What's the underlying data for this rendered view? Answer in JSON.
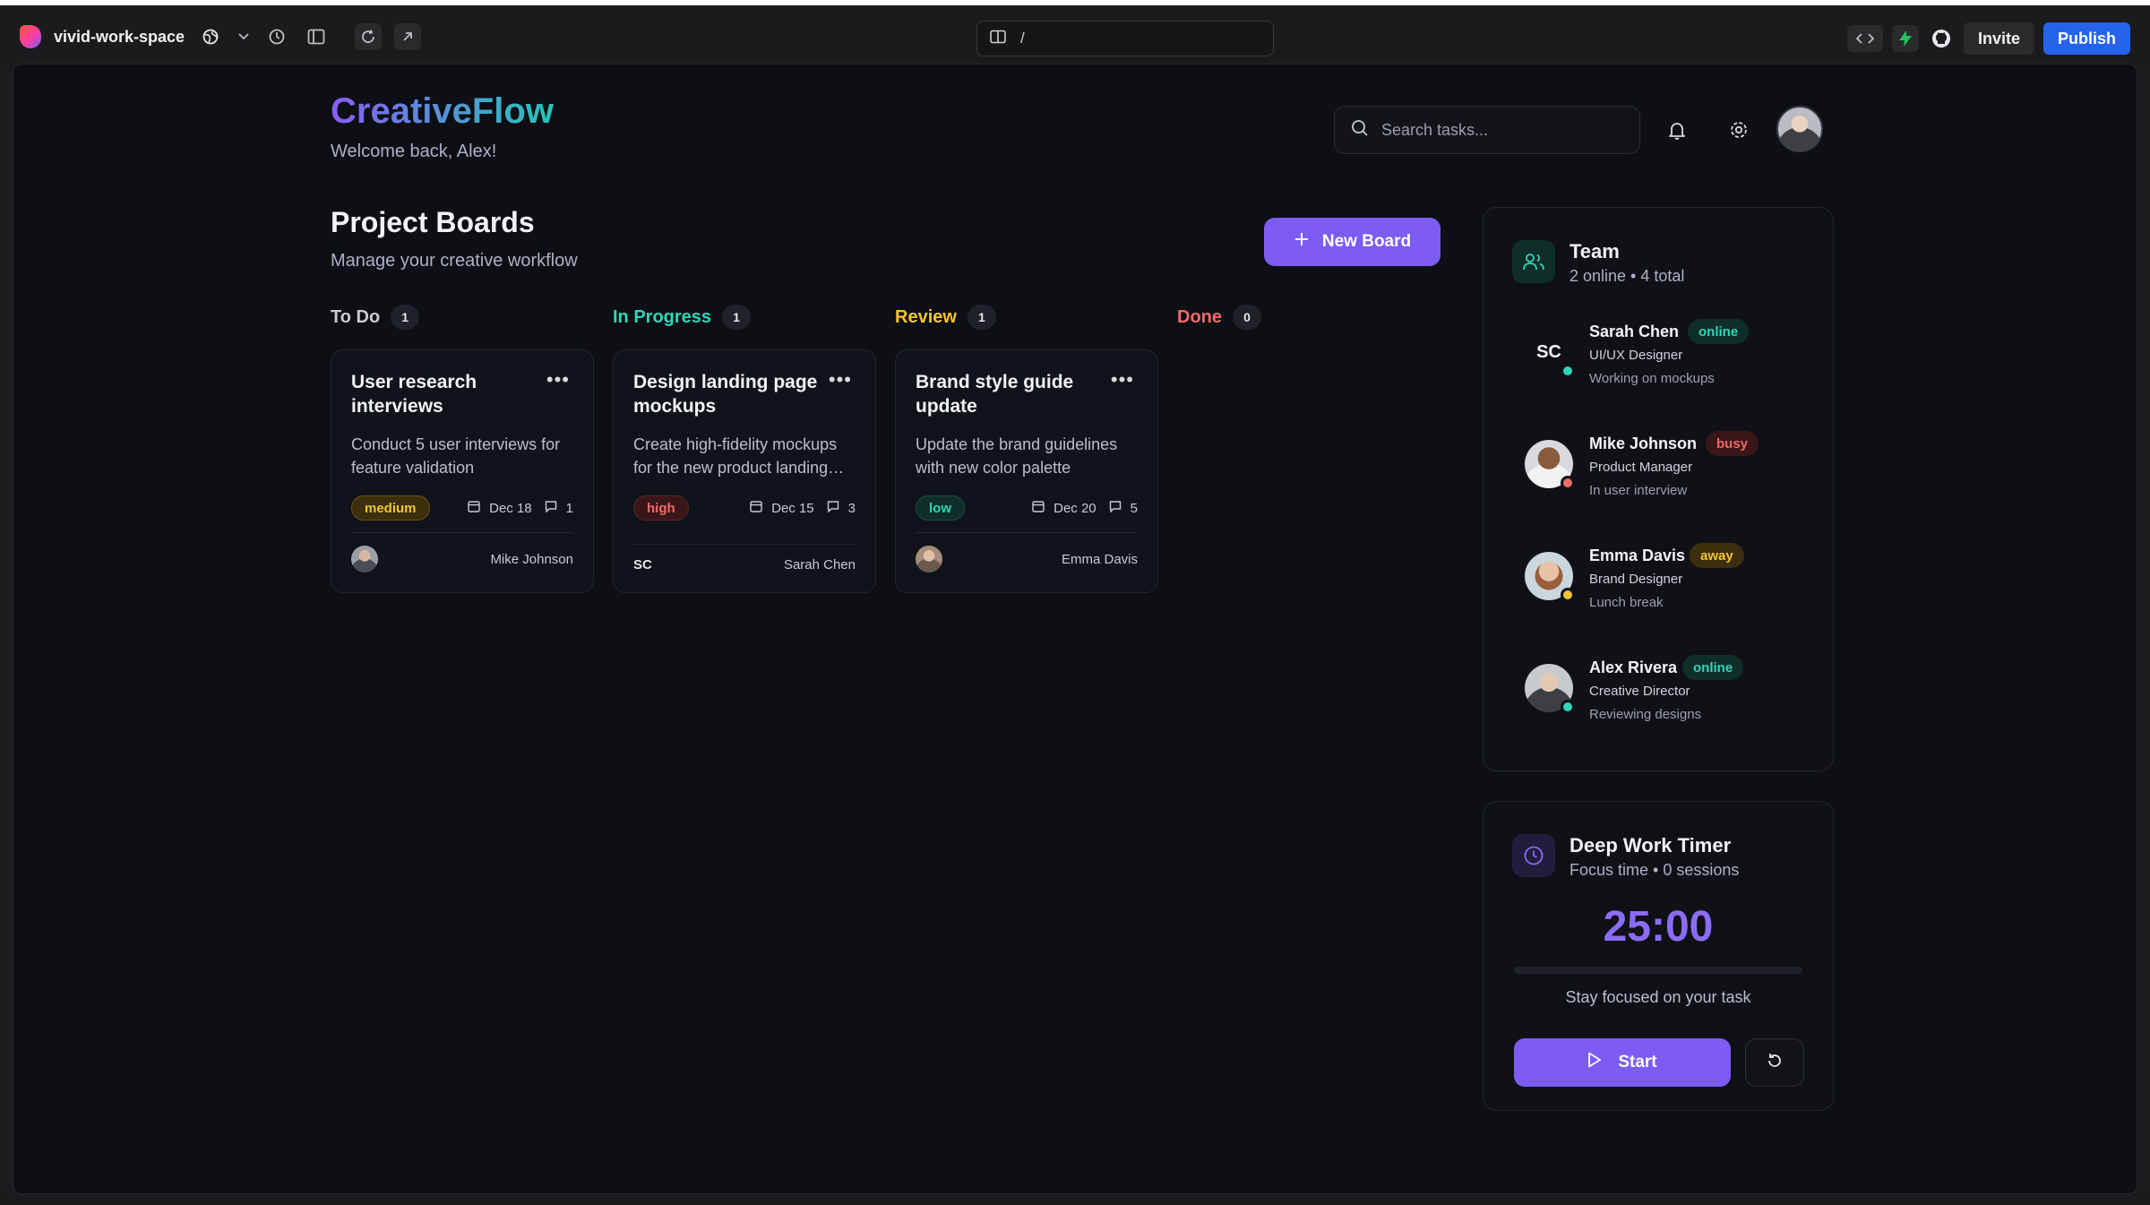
{
  "browser": {
    "project_name": "vivid-work-space",
    "url_path": "/",
    "invite_label": "Invite",
    "publish_label": "Publish"
  },
  "header": {
    "brand": "CreativeFlow",
    "welcome": "Welcome back, Alex!",
    "search_placeholder": "Search tasks..."
  },
  "boards": {
    "title": "Project Boards",
    "subtitle": "Manage your creative workflow",
    "new_board_label": "New Board",
    "columns": [
      {
        "title": "To Do",
        "count": "1",
        "color": "#c9ccd4"
      },
      {
        "title": "In Progress",
        "count": "1",
        "color": "#2fd6b6"
      },
      {
        "title": "Review",
        "count": "1",
        "color": "#f4c430"
      },
      {
        "title": "Done",
        "count": "0",
        "color": "#f06a6a"
      }
    ],
    "cards": [
      {
        "title": "User research interviews",
        "desc": "Conduct 5 user interviews for feature validation",
        "priority": "medium",
        "date": "Dec 18",
        "comments": "1",
        "assignee": "Mike Johnson"
      },
      {
        "title": "Design landing page mockups",
        "desc": "Create high-fidelity mockups for the new product landing…",
        "priority": "high",
        "date": "Dec 15",
        "comments": "3",
        "assignee": "Sarah Chen",
        "assignee_initials": "SC"
      },
      {
        "title": "Brand style guide update",
        "desc": "Update the brand guidelines with new color palette",
        "priority": "low",
        "date": "Dec 20",
        "comments": "5",
        "assignee": "Emma Davis"
      }
    ]
  },
  "team": {
    "title": "Team",
    "subtitle": "2 online • 4 total",
    "members": [
      {
        "initials": "SC",
        "name": "Sarah Chen",
        "badge": "online",
        "role": "UI/UX Designer",
        "status": "Working on mockups"
      },
      {
        "name": "Mike Johnson",
        "badge": "busy",
        "role": "Product Manager",
        "status": "In user interview"
      },
      {
        "name": "Emma Davis",
        "badge": "away",
        "role": "Brand Designer",
        "status": "Lunch break"
      },
      {
        "name": "Alex Rivera",
        "badge": "online",
        "role": "Creative Director",
        "status": "Reviewing designs"
      }
    ]
  },
  "timer": {
    "title": "Deep Work Timer",
    "subtitle": "Focus time • 0 sessions",
    "time": "25:00",
    "progress": 0,
    "hint": "Stay focused on your task",
    "start_label": "Start"
  }
}
